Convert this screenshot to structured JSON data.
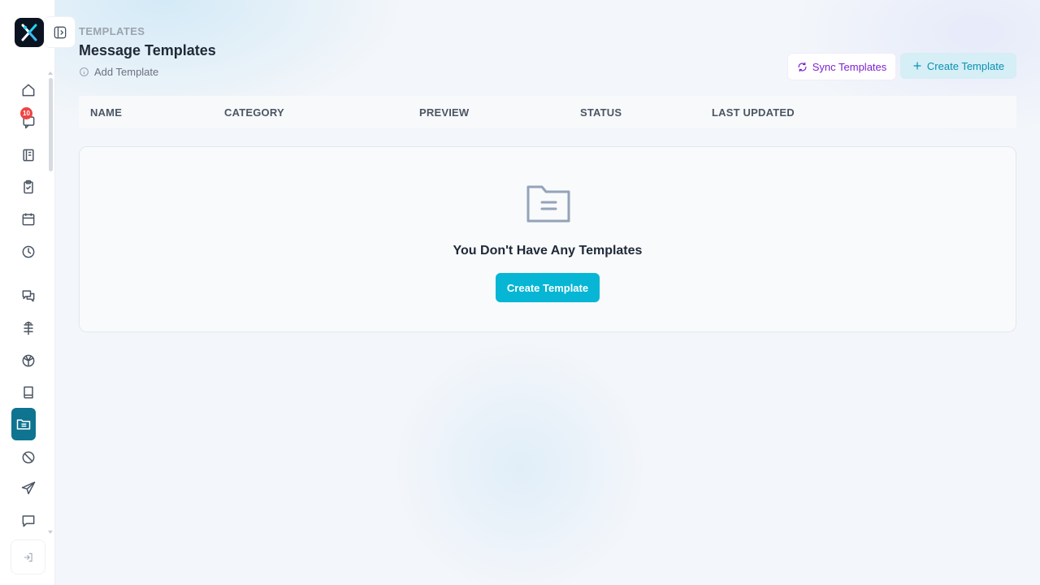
{
  "header": {
    "breadcrumb": "TEMPLATES",
    "title": "Message Templates",
    "hint": "Add Template",
    "sync_label": "Sync Templates",
    "create_label": "Create Template"
  },
  "sidebar": {
    "notification_badge": "10",
    "items": [
      {
        "icon": "home-icon"
      },
      {
        "icon": "notifications-icon"
      },
      {
        "icon": "notebook-icon"
      },
      {
        "icon": "clipboard-check-icon"
      },
      {
        "icon": "calendar-icon"
      },
      {
        "icon": "clock-icon"
      },
      {
        "icon": "chat-icon"
      },
      {
        "icon": "split-icon"
      },
      {
        "icon": "cube-icon"
      },
      {
        "icon": "book-icon"
      },
      {
        "icon": "templates-folder-icon"
      },
      {
        "icon": "block-icon"
      },
      {
        "icon": "send-icon"
      },
      {
        "icon": "message-icon"
      }
    ]
  },
  "table": {
    "columns": [
      "NAME",
      "CATEGORY",
      "PREVIEW",
      "STATUS",
      "LAST UPDATED"
    ]
  },
  "empty_state": {
    "title": "You Don't Have Any Templates",
    "button": "Create Template"
  },
  "colors": {
    "accent": "#06b6d4",
    "active_nav": "#0e7490",
    "sync_text": "#7e22ce",
    "badge": "#ef4444"
  }
}
